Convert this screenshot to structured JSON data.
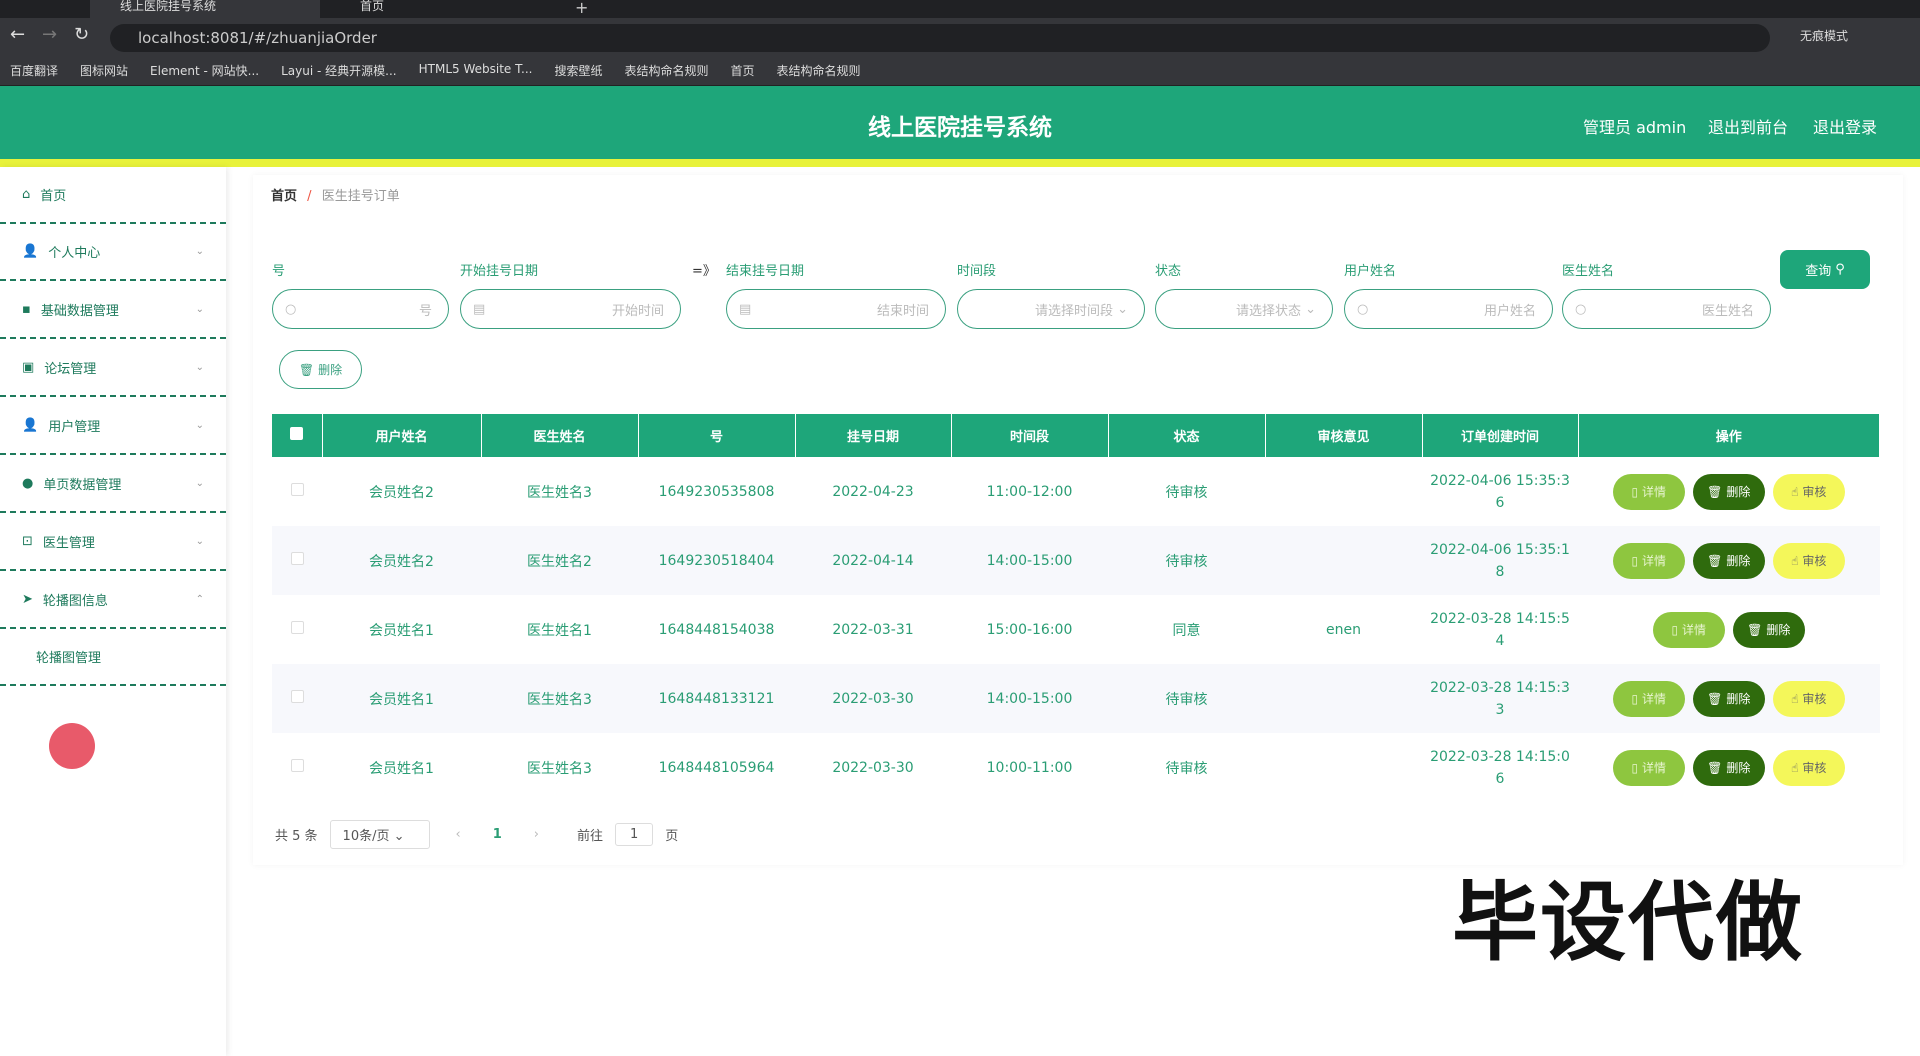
{
  "browser": {
    "tabs": [
      {
        "label": "线上医院挂号系统"
      },
      {
        "label": "首页"
      }
    ],
    "url": "localhost:8081/#/zhuanjiaOrder",
    "profile": "无痕模式",
    "bookmarks": [
      "百度翻译",
      "图标网站",
      "Element - 网站快...",
      "Layui - 经典开源模...",
      "HTML5 Website T...",
      "搜索壁纸",
      "表结构命名规则",
      "首页",
      "表结构命名规则"
    ]
  },
  "header": {
    "title": "线上医院挂号系统",
    "admin": "管理员 admin",
    "to_front": "退出到前台",
    "logout": "退出登录"
  },
  "sidebar": {
    "items": [
      {
        "label": "首页"
      },
      {
        "label": "个人中心"
      },
      {
        "label": "基础数据管理"
      },
      {
        "label": "论坛管理"
      },
      {
        "label": "用户管理"
      },
      {
        "label": "单页数据管理"
      },
      {
        "label": "医生管理"
      },
      {
        "label": "轮播图信息"
      },
      {
        "label": "轮播图管理"
      }
    ]
  },
  "breadcrumb": {
    "home": "首页",
    "sep": "/",
    "current": "医生挂号订单"
  },
  "filters": {
    "no_label": "号",
    "no_ph": "号",
    "start_label": "开始挂号日期",
    "start_ph": "开始时间",
    "arrow": "=》",
    "end_label": "结束挂号日期",
    "end_ph": "结束时间",
    "slot_label": "时间段",
    "slot_ph": "请选择时间段",
    "status_label": "状态",
    "status_ph": "请选择状态",
    "user_label": "用户姓名",
    "user_ph": "用户姓名",
    "doctor_label": "医生姓名",
    "doctor_ph": "医生姓名",
    "query": "查询",
    "delete": "删除"
  },
  "table": {
    "headers": [
      "用户姓名",
      "医生姓名",
      "号",
      "挂号日期",
      "时间段",
      "状态",
      "审核意见",
      "订单创建时间",
      "操作"
    ],
    "rows": [
      [
        "会员姓名2",
        "医生姓名3",
        "1649230535808",
        "2022-04-23",
        "11:00-12:00",
        "待审核",
        "",
        "2022-04-06 15:35:36"
      ],
      [
        "会员姓名2",
        "医生姓名2",
        "1649230518404",
        "2022-04-14",
        "14:00-15:00",
        "待审核",
        "",
        "2022-04-06 15:35:18"
      ],
      [
        "会员姓名1",
        "医生姓名1",
        "1648448154038",
        "2022-03-31",
        "15:00-16:00",
        "同意",
        "enen",
        "2022-03-28 14:15:54"
      ],
      [
        "会员姓名1",
        "医生姓名3",
        "1648448133121",
        "2022-03-30",
        "14:00-15:00",
        "待审核",
        "",
        "2022-03-28 14:15:33"
      ],
      [
        "会员姓名1",
        "医生姓名3",
        "1648448105964",
        "2022-03-30",
        "10:00-11:00",
        "待审核",
        "",
        "2022-03-28 14:15:06"
      ]
    ],
    "actions": {
      "detail": "详情",
      "delete": "删除",
      "review": "审核"
    },
    "reviewable": [
      true,
      true,
      false,
      true,
      true
    ]
  },
  "pagination": {
    "total": "共 5 条",
    "page_size": "10条/页",
    "current": "1",
    "goto": "前往",
    "goto_value": "1",
    "page_unit": "页"
  },
  "watermark": "毕设代做"
}
